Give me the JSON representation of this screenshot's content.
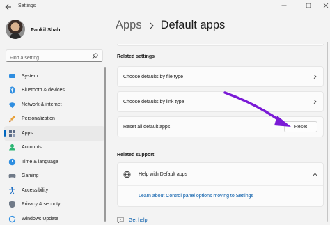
{
  "window": {
    "title": "Settings"
  },
  "user": {
    "name": "Pankil Shah"
  },
  "search": {
    "placeholder": "Find a setting"
  },
  "sidebar": {
    "items": [
      {
        "label": "System",
        "icon": "system-icon",
        "active": false
      },
      {
        "label": "Bluetooth & devices",
        "icon": "bluetooth-icon",
        "active": false
      },
      {
        "label": "Network & internet",
        "icon": "wifi-icon",
        "active": false
      },
      {
        "label": "Personalization",
        "icon": "brush-icon",
        "active": false
      },
      {
        "label": "Apps",
        "icon": "apps-icon",
        "active": true
      },
      {
        "label": "Accounts",
        "icon": "accounts-icon",
        "active": false
      },
      {
        "label": "Time & language",
        "icon": "globe-clock-icon",
        "active": false
      },
      {
        "label": "Gaming",
        "icon": "gamepad-icon",
        "active": false
      },
      {
        "label": "Accessibility",
        "icon": "accessibility-icon",
        "active": false
      },
      {
        "label": "Privacy & security",
        "icon": "shield-icon",
        "active": false
      },
      {
        "label": "Windows Update",
        "icon": "update-icon",
        "active": false
      }
    ]
  },
  "breadcrumb": {
    "parent": "Apps",
    "current": "Default apps"
  },
  "related_settings": {
    "title": "Related settings",
    "file_type": "Choose defaults by file type",
    "link_type": "Choose defaults by link type",
    "reset_all": "Reset all default apps",
    "reset_button": "Reset"
  },
  "related_support": {
    "title": "Related support",
    "help_title": "Help with Default apps",
    "help_link": "Learn about Control panel options moving to Settings"
  },
  "footer": {
    "get_help": "Get help"
  },
  "colors": {
    "accent": "#0067c0",
    "link": "#0058a8",
    "annotation_arrow": "#7a1ad6"
  }
}
